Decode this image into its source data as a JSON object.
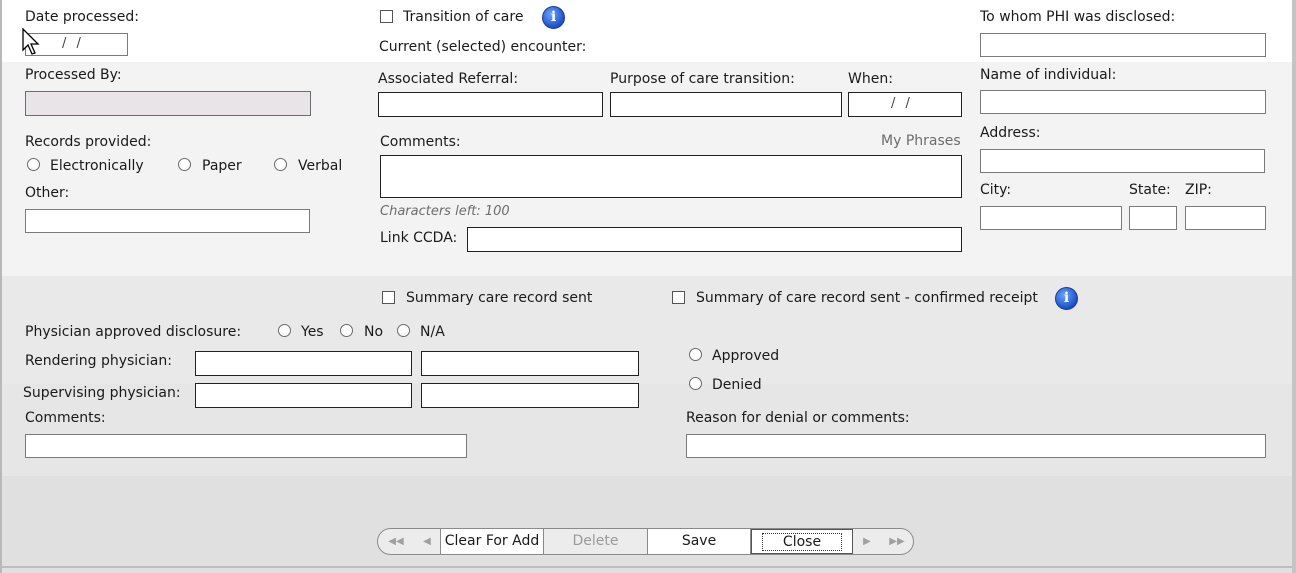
{
  "top": {
    "date_processed_label": "Date processed:",
    "date_processed_value": "/ /",
    "transition_of_care_label": "Transition of care",
    "current_encounter_label": "Current (selected) encounter:",
    "to_whom_phi_label": "To whom PHI was disclosed:"
  },
  "mid": {
    "processed_by_label": "Processed By:",
    "associated_referral_label": "Associated Referral:",
    "purpose_label": "Purpose of care transition:",
    "when_label": "When:",
    "when_value": "/ /",
    "name_individual_label": "Name of individual:",
    "records_provided_label": "Records provided:",
    "electronically_label": "Electronically",
    "paper_label": "Paper",
    "verbal_label": "Verbal",
    "other_label": "Other:",
    "comments_label": "Comments:",
    "my_phrases_label": "My Phrases",
    "characters_left": "Characters left: 100",
    "link_ccda_label": "Link CCDA:",
    "address_label": "Address:",
    "city_label": "City:",
    "state_label": "State:",
    "zip_label": "ZIP:"
  },
  "summary": {
    "summary_sent_label": "Summary care record sent",
    "summary_confirmed_label": "Summary of care record sent - confirmed receipt",
    "physician_approved_label": "Physician approved disclosure:",
    "yes_label": "Yes",
    "no_label": "No",
    "na_label": "N/A",
    "rendering_physician_label": "Rendering physician:",
    "supervising_physician_label": "Supervising physician:",
    "approved_label": "Approved",
    "denied_label": "Denied",
    "comments_label": "Comments:",
    "reason_label": "Reason for denial or comments:"
  },
  "nav": {
    "first_icon": "double-left-arrow-icon",
    "prev_icon": "left-arrow-icon",
    "clear_for_add": "Clear For Add",
    "delete": "Delete",
    "save": "Save",
    "close": "Close",
    "next_icon": "right-arrow-icon",
    "last_icon": "double-right-arrow-icon"
  },
  "colors": {
    "info_icon": "#1d4fc4",
    "processed_by_fill": "#e8e4e8"
  }
}
